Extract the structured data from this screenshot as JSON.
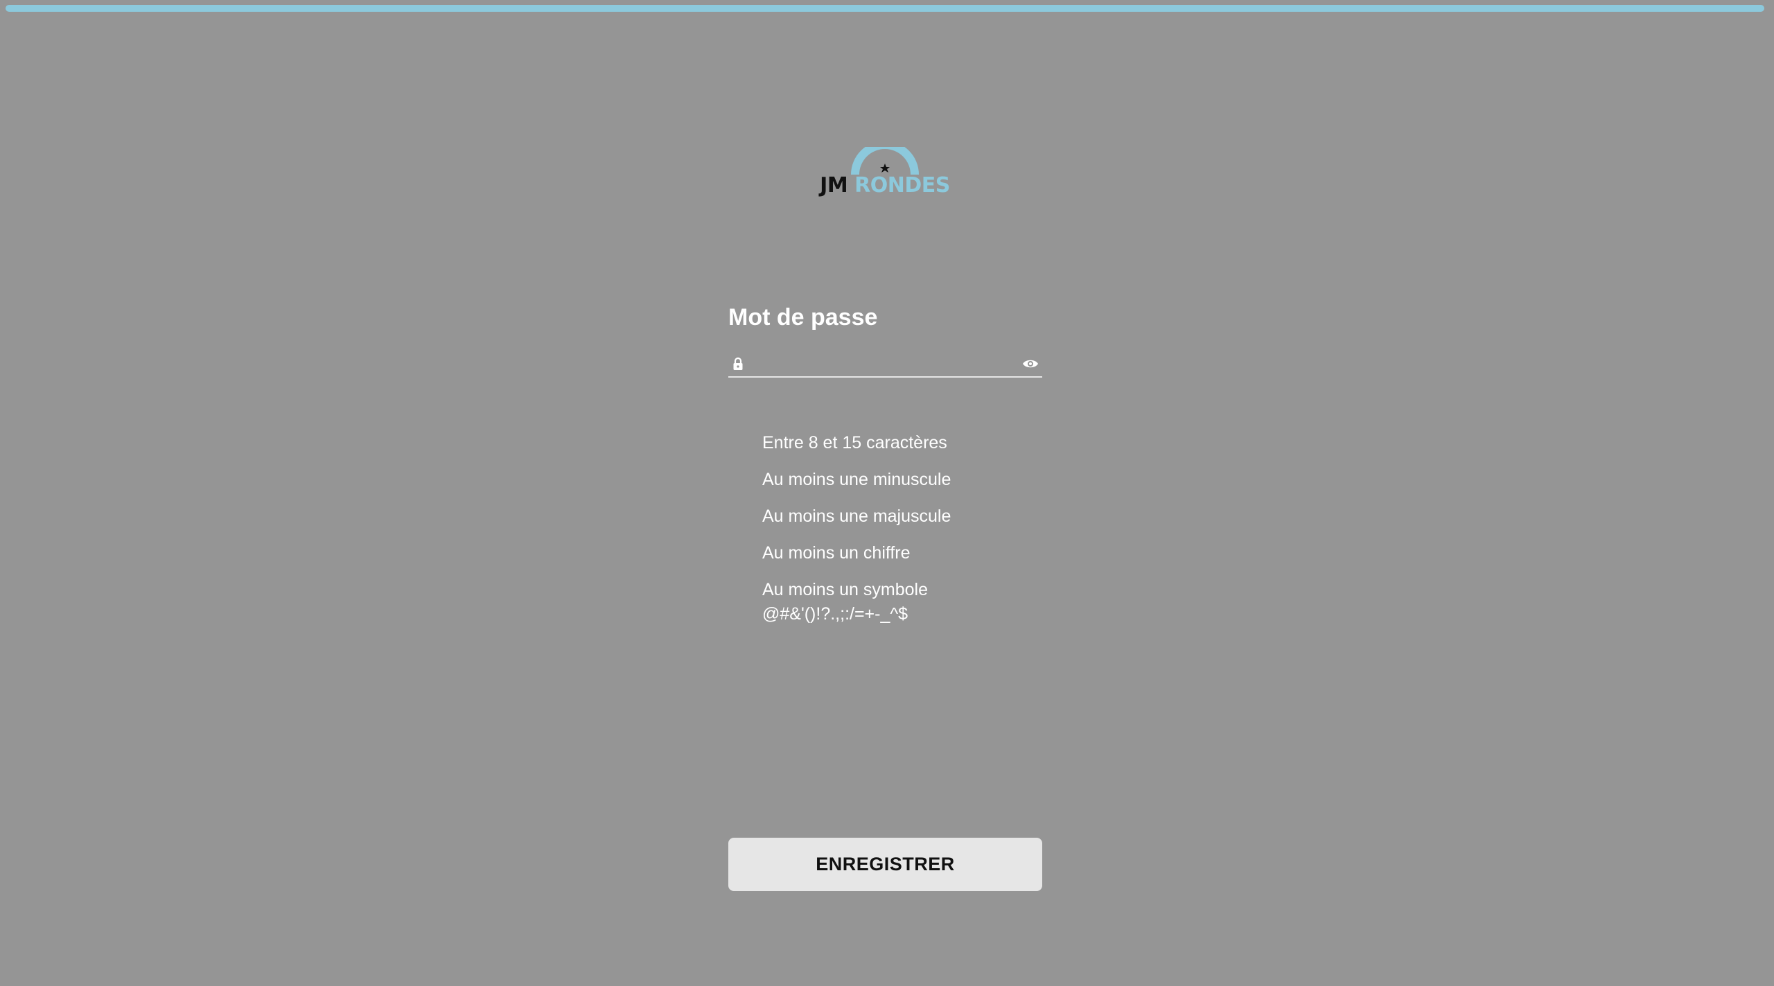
{
  "header": {
    "progress_percent": 100,
    "accent_color": "#8cc9dc"
  },
  "logo": {
    "part1": "JM",
    "part2": "RONDES",
    "icon": "rainbow-star-logo"
  },
  "form": {
    "password_label": "Mot de passe",
    "password_value": "",
    "lock_icon": "lock-icon",
    "reveal_icon": "eye-icon",
    "rules": [
      {
        "text": "Entre 8 et 15 caractères"
      },
      {
        "text": "Au moins une minuscule"
      },
      {
        "text": "Au moins une majuscule"
      },
      {
        "text": "Au moins un chiffre"
      },
      {
        "text": "Au moins un symbole",
        "detail": "@#&'()!?.,;:/=+-_^$"
      }
    ],
    "submit_label": "ENREGISTRER"
  }
}
